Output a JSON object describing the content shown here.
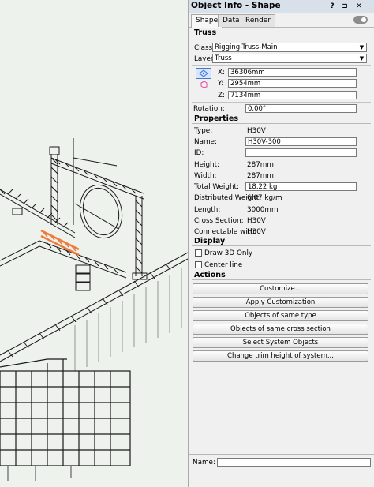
{
  "window": {
    "title": "Object Info - Shape",
    "buttons": [
      "?",
      "⊐",
      "✕"
    ]
  },
  "tabs": [
    {
      "label": "Shape",
      "active": true
    },
    {
      "label": "Data",
      "active": false
    },
    {
      "label": "Render",
      "active": false
    }
  ],
  "object": {
    "name_header": "Truss",
    "class_label": "Class:",
    "class_value": "Rigging-Truss-Main",
    "layer_label": "Layer:",
    "layer_value": "Truss",
    "x_label": "X:",
    "x_value": "36306mm",
    "y_label": "Y:",
    "y_value": "2954mm",
    "z_label": "Z:",
    "z_value": "7134mm",
    "rotation_label": "Rotation:",
    "rotation_value": "0.00°"
  },
  "properties": {
    "header": "Properties",
    "type_label": "Type:",
    "type_value": "H30V",
    "name_label": "Name:",
    "name_value": "H30V-300",
    "id_label": "ID:",
    "id_value": "",
    "height_label": "Height:",
    "height_value": "287mm",
    "width_label": "Width:",
    "width_value": "287mm",
    "total_weight_label": "Total Weight:",
    "total_weight_value": "18.22 kg",
    "dist_weight_label": "Distributed Weight:",
    "dist_weight_value": "6.07 kg/m",
    "length_label": "Length:",
    "length_value": "3000mm",
    "cross_section_label": "Cross Section:",
    "cross_section_value": "H30V",
    "connectable_label": "Connectable with:",
    "connectable_value": "H30V"
  },
  "display": {
    "header": "Display",
    "draw3d_label": "Draw 3D Only",
    "centerline_label": "Center line"
  },
  "actions": {
    "header": "Actions",
    "buttons": [
      "Customize...",
      "Apply Customization",
      "Objects of same type",
      "Objects of same cross section",
      "Select System Objects",
      "Change trim height of system..."
    ]
  },
  "namefield": {
    "label": "Name:",
    "value": ""
  },
  "colors": {
    "viewport_bg": "#edf3ec",
    "selection_orange": "#f07a3a",
    "palette_bg": "#f0f0f0"
  }
}
